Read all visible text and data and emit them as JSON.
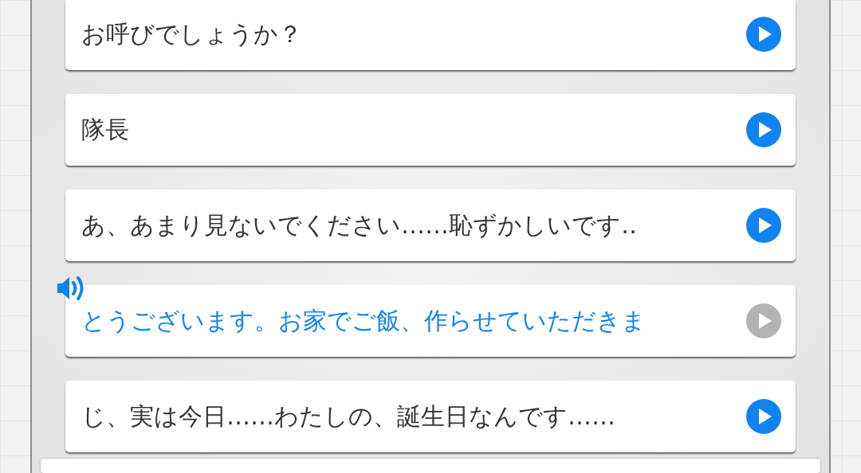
{
  "lines": [
    {
      "text": "お呼びでしょうか？",
      "playing": false
    },
    {
      "text": "隊長",
      "playing": false
    },
    {
      "text": "あ、あまり見ないでください……恥ずかしいです‥",
      "playing": false
    },
    {
      "text": "とうございます。お家でご飯、作らせていただきま",
      "playing": true
    },
    {
      "text": "じ、実は今日……わたしの、誕生日なんです……",
      "playing": false
    }
  ]
}
